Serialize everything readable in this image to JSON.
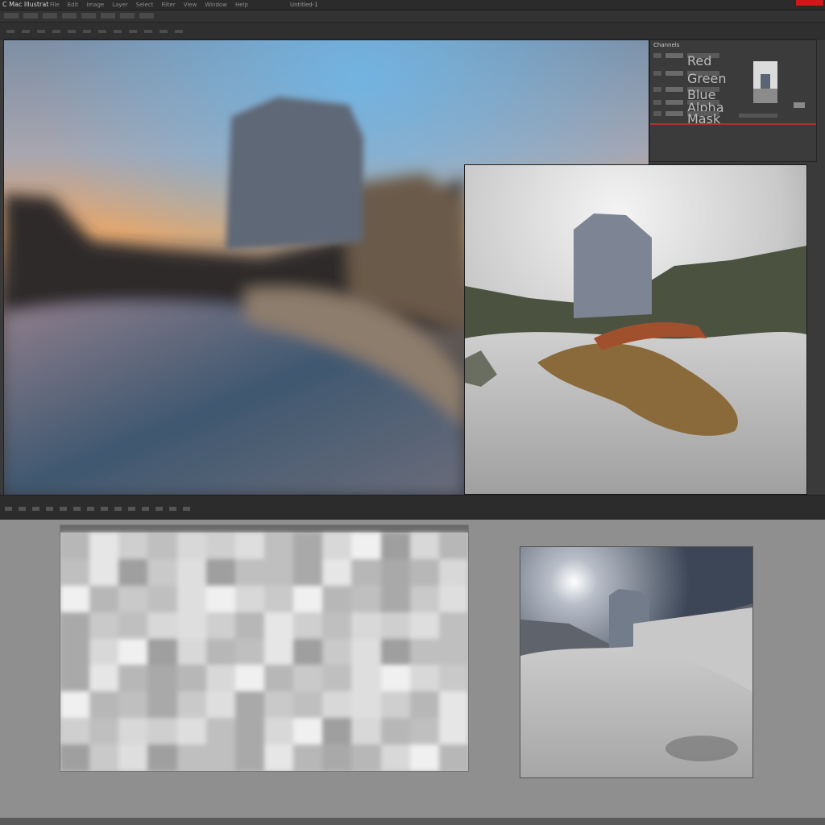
{
  "app": {
    "title": "C Mac Illustrat"
  },
  "menus": [
    "File",
    "Edit",
    "Image",
    "Layer",
    "Select",
    "Filter",
    "View",
    "Window",
    "Help"
  ],
  "document": {
    "title": "Untitled-1"
  },
  "panel": {
    "title": "Channels",
    "rows": [
      "Red",
      "Green",
      "Blue",
      "Alpha",
      "Mask"
    ]
  },
  "colors": {
    "accent": "#b23030",
    "close": "#d01818",
    "chrome": "#2b2b2b",
    "lower_bg": "#8f8f8f"
  }
}
